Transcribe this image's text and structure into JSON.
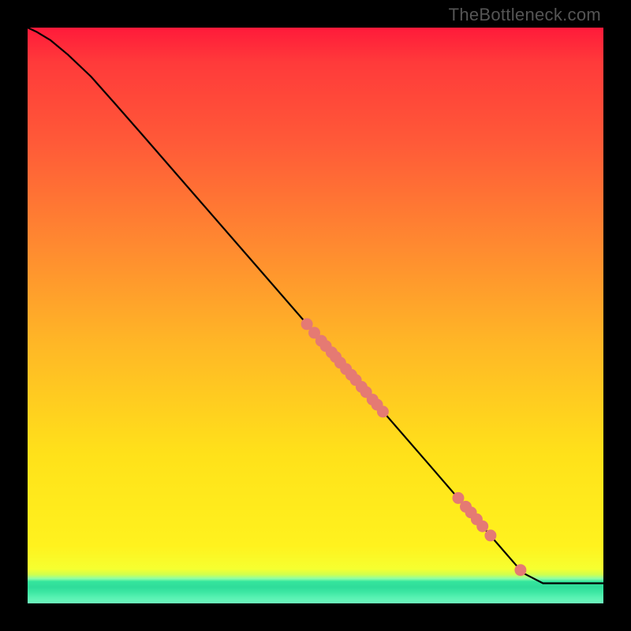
{
  "watermark": "TheBottleneck.com",
  "colors": {
    "dot": "#e57a73",
    "line": "#000000",
    "frame": "#000000"
  },
  "chart_data": {
    "type": "line",
    "title": "",
    "xlabel": "",
    "ylabel": "",
    "xlim": [
      0,
      100
    ],
    "ylim": [
      0,
      100
    ],
    "grid": false,
    "legend": false,
    "note": "Axes have no tick labels; x/y are normalized 0–100 to the visible plot box. Curve descends from top-left to a plateau near bottom-right at y≈3.5 (inside the green band). Dots lie on the curve.",
    "series": [
      {
        "name": "curve",
        "kind": "line",
        "x": [
          0.0,
          1.5,
          4.0,
          7.0,
          11.0,
          15.0,
          20.0,
          30.0,
          40.0,
          50.0,
          60.0,
          70.0,
          80.0,
          86.0,
          89.5,
          100.0
        ],
        "y": [
          100.0,
          99.3,
          97.8,
          95.3,
          91.5,
          87.0,
          81.3,
          69.8,
          58.3,
          46.8,
          35.3,
          23.8,
          12.2,
          5.3,
          3.5,
          3.5
        ]
      },
      {
        "name": "dots",
        "kind": "scatter",
        "x": [
          48.5,
          49.8,
          51.0,
          51.8,
          52.8,
          53.5,
          54.3,
          55.3,
          56.2,
          57.0,
          58.0,
          58.8,
          59.9,
          60.7,
          61.7,
          74.8,
          76.1,
          77.0,
          78.0,
          79.0,
          80.4,
          85.6
        ],
        "y": [
          48.5,
          47.0,
          45.6,
          44.7,
          43.6,
          42.8,
          41.8,
          40.7,
          39.7,
          38.8,
          37.6,
          36.7,
          35.4,
          34.5,
          33.3,
          18.3,
          16.8,
          15.8,
          14.6,
          13.4,
          11.8,
          5.8
        ]
      }
    ]
  }
}
